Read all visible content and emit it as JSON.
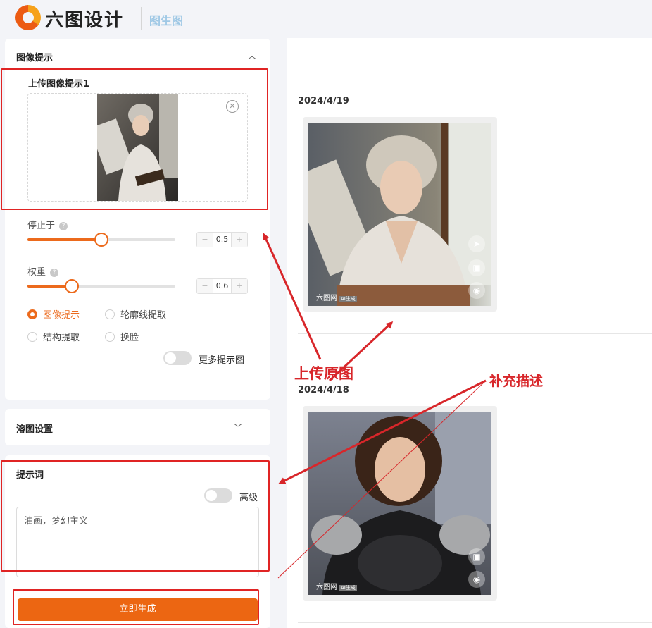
{
  "header": {
    "brand": "六图设计",
    "subtitle": "图生图"
  },
  "image_prompt_panel": {
    "title": "图像提示",
    "upload_label": "上传图像提示1",
    "stop_at_label": "停止于",
    "stop_at_value": "0.5",
    "weight_label": "权重",
    "weight_value": "0.6",
    "modes": [
      {
        "label": "图像提示",
        "selected": true
      },
      {
        "label": "轮廓线提取",
        "selected": false
      },
      {
        "label": "结构提取",
        "selected": false
      },
      {
        "label": "换脸",
        "selected": false
      }
    ],
    "more_prompt_label": "更多提示图"
  },
  "blend_panel": {
    "title": "溶图设置"
  },
  "prompt_panel": {
    "title": "提示词",
    "advanced_label": "高级",
    "text": "油画，梦幻主义"
  },
  "generate_button": "立即生成",
  "results": [
    {
      "date": "2024/4/19",
      "watermark": "六图网",
      "badge": "AI生成"
    },
    {
      "date": "2024/4/18",
      "watermark": "六图网",
      "badge": "AI生成"
    }
  ],
  "annotations": {
    "upload_original": "上传原图",
    "supplement": "补充描述"
  },
  "colors": {
    "accent": "#ec6612",
    "annotation_red": "#d8262a"
  }
}
